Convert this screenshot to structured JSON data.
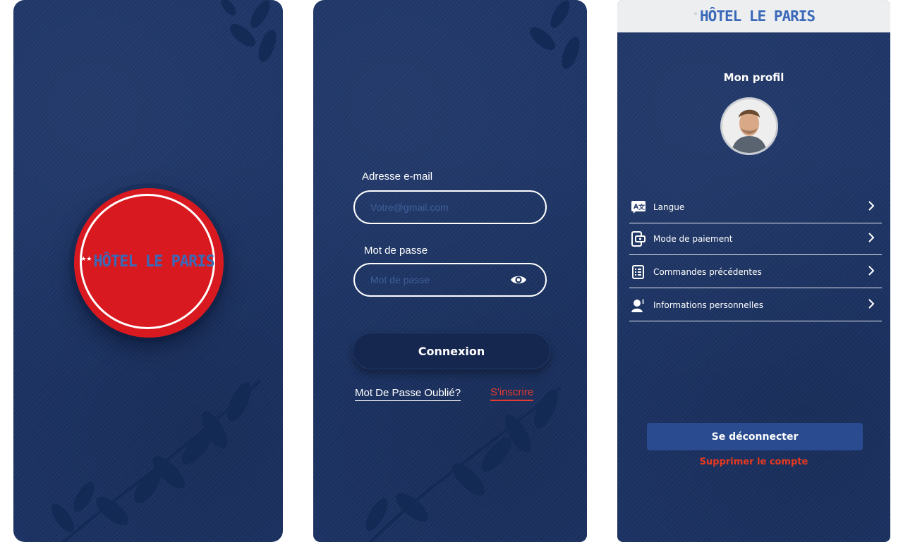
{
  "brand": {
    "logo_text": "HÔTEL LE PARIS",
    "colors": {
      "navy": "#1b3366",
      "red": "#d91920",
      "logo_blue": "#3a69b8",
      "link_red": "#e53a2f"
    }
  },
  "splash": {
    "logo_text": "HÔTEL LE PARIS",
    "logo_stars": "★★"
  },
  "login": {
    "email_label": "Adresse e-mail",
    "email_placeholder": "Votre@gmail.com",
    "password_label": "Mot de passe",
    "password_placeholder": "Mot de passe",
    "login_button": "Connexion",
    "forgot_link": "Mot De Passe Oublié?",
    "signup_link": "S'inscrire",
    "icons": {
      "visibility": "eye-icon"
    }
  },
  "profile": {
    "header_logo_text": "HÔTEL LE PARIS",
    "title": "Mon profil",
    "menu": [
      {
        "label": "Langue",
        "icon": "translate-icon"
      },
      {
        "label": "Mode de paiement",
        "icon": "payment-icon"
      },
      {
        "label": "Commandes précédentes",
        "icon": "orders-icon"
      },
      {
        "label": "Informations personnelles",
        "icon": "person-info-icon"
      }
    ],
    "logout_button": "Se déconnecter",
    "delete_link": "Supprimer le compte"
  }
}
